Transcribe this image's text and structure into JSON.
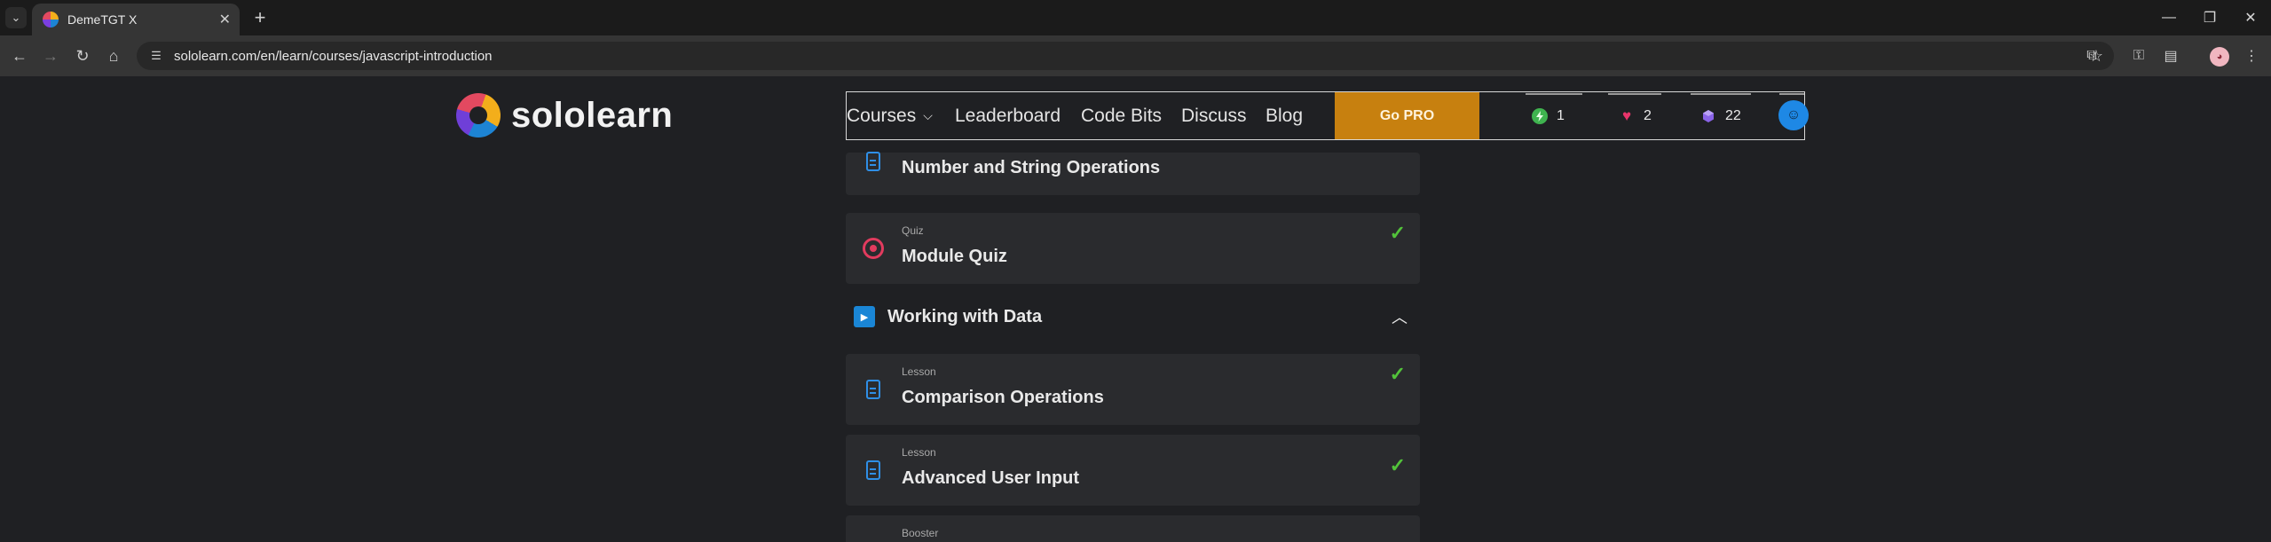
{
  "browser": {
    "tab_title": "DemeTGT X",
    "tab_close": "✕",
    "new_tab": "+",
    "url": "sololearn.com/en/learn/courses/javascript-introduction",
    "window_controls": [
      "—",
      "❐",
      "✕"
    ]
  },
  "header": {
    "logo_text": "sololearn",
    "nav": {
      "courses": "Courses",
      "leaderboard": "Leaderboard",
      "code_bits": "Code Bits",
      "discuss": "Discuss",
      "blog": "Blog"
    },
    "go_pro": "Go PRO",
    "stats": {
      "streak": "1",
      "hearts": "2",
      "gems": "22"
    }
  },
  "course": {
    "items_before": [
      {
        "type": "",
        "title": "Number and String Operations",
        "icon": "lesson-icon",
        "completed": false
      },
      {
        "type": "Quiz",
        "title": "Module Quiz",
        "icon": "quiz-icon",
        "completed": true
      }
    ],
    "module": {
      "title": "Working with Data",
      "expanded": true
    },
    "items_after": [
      {
        "type": "Lesson",
        "title": "Comparison Operations",
        "icon": "lesson-icon",
        "completed": true
      },
      {
        "type": "Lesson",
        "title": "Advanced User Input",
        "icon": "lesson-icon",
        "completed": true
      },
      {
        "type": "Booster",
        "title": "",
        "icon": "booster-icon",
        "completed": false
      }
    ]
  },
  "colors": {
    "go_pro": "#c7800f",
    "check": "#52c23a",
    "lesson_icon": "#2f8fe6",
    "quiz_icon": "#e23b5e",
    "card_bg": "#2a2b2e",
    "page_bg": "#1f2023"
  }
}
